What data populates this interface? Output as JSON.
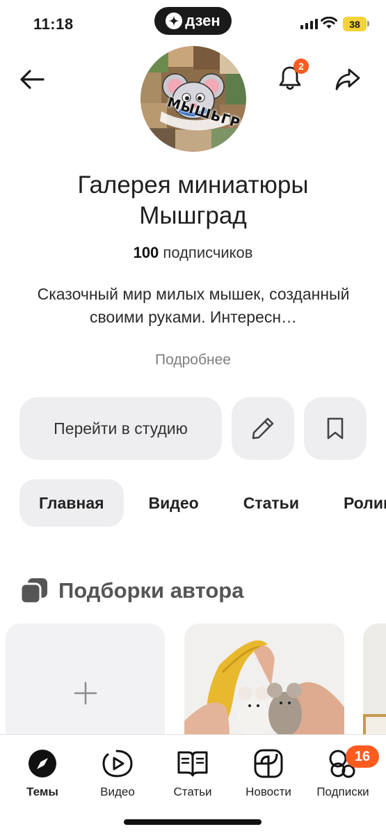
{
  "status_bar": {
    "time": "11:18",
    "app_badge": "дзен",
    "battery": "38"
  },
  "header": {
    "notifications_count": "2",
    "avatar_text": "МЫШЬГРАД"
  },
  "channel": {
    "name": "Галерея миниатюры Мышград",
    "subscribers_count": "100",
    "subscribers_label": " подписчиков",
    "description": "Сказочный мир милых мышек, созданный своими руками. Интересн…",
    "more_label": "Подробнее"
  },
  "actions": {
    "studio_label": "Перейти в студию"
  },
  "tabs": [
    {
      "label": "Главная",
      "active": true
    },
    {
      "label": "Видео",
      "active": false
    },
    {
      "label": "Статьи",
      "active": false
    },
    {
      "label": "Ролики",
      "active": false
    }
  ],
  "section": {
    "title": "Подборки автора"
  },
  "bottom_nav": {
    "items": [
      {
        "label": "Темы",
        "icon": "compass-icon",
        "active": true
      },
      {
        "label": "Видео",
        "icon": "play-icon",
        "active": false
      },
      {
        "label": "Статьи",
        "icon": "book-icon",
        "active": false
      },
      {
        "label": "Новости",
        "icon": "news-icon",
        "active": false
      },
      {
        "label": "Подписки",
        "icon": "subscriptions-icon",
        "active": false
      }
    ],
    "subscriptions_badge": "16"
  },
  "colors": {
    "accent": "#ff5a1f",
    "chip_bg": "#eeeef0",
    "battery": "#f4d23a"
  }
}
